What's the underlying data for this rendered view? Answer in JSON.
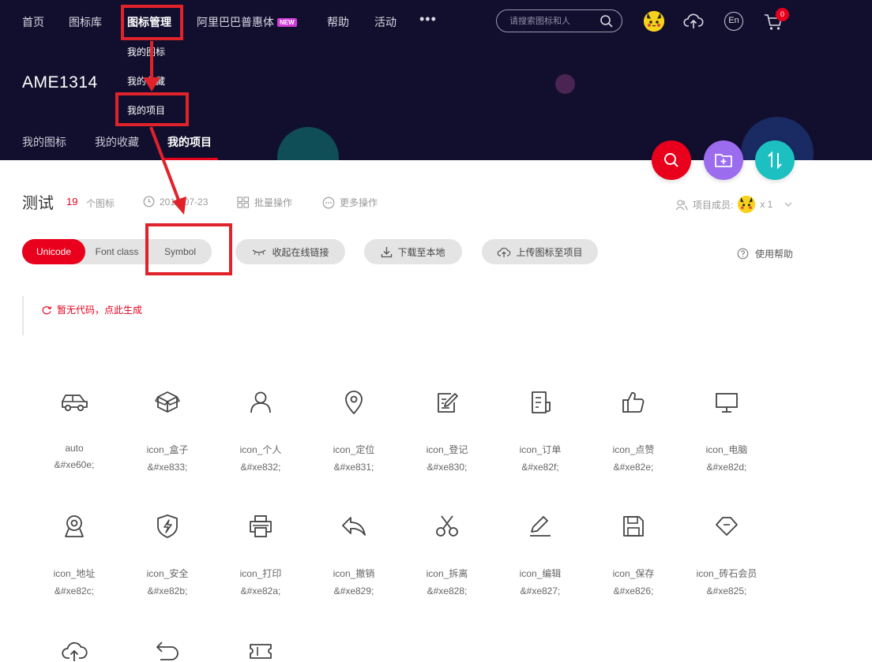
{
  "nav": {
    "items": [
      {
        "label": "首页"
      },
      {
        "label": "图标库"
      },
      {
        "label": "图标管理"
      },
      {
        "label": "阿里巴巴普惠体",
        "badge": "NEW"
      },
      {
        "label": "帮助"
      },
      {
        "label": "活动"
      }
    ],
    "more": "•••",
    "search_placeholder": "请搜索图标和人",
    "lang": "En",
    "cart_count": "0"
  },
  "dropdown": [
    "我的图标",
    "我的收藏",
    "我的项目"
  ],
  "user": {
    "name": "AME1314"
  },
  "subnav": [
    "我的图标",
    "我的收藏",
    "我的项目"
  ],
  "project": {
    "name": "测试",
    "count": "19",
    "count_label": "个图标",
    "date": "2019-07-23",
    "batch": "批量操作",
    "more": "更多操作",
    "members_label": "项目成员:",
    "members_count": "x 1"
  },
  "tabs": [
    "Unicode",
    "Font class",
    "Symbol"
  ],
  "actions": {
    "collapse": "收起在线链接",
    "download": "下载至本地",
    "upload": "上传图标至项目",
    "help": "使用帮助"
  },
  "code_area": {
    "generate": "暂无代码，点此生成"
  },
  "icons": [
    {
      "name": "auto",
      "code": "&#xe60e;",
      "icon": "car-icon"
    },
    {
      "name": "icon_盒子",
      "code": "&#xe833;",
      "icon": "box-icon"
    },
    {
      "name": "icon_个人",
      "code": "&#xe832;",
      "icon": "person-icon"
    },
    {
      "name": "icon_定位",
      "code": "&#xe831;",
      "icon": "location-pin-icon"
    },
    {
      "name": "icon_登记",
      "code": "&#xe830;",
      "icon": "register-icon"
    },
    {
      "name": "icon_订单",
      "code": "&#xe82f;",
      "icon": "order-icon"
    },
    {
      "name": "icon_点赞",
      "code": "&#xe82e;",
      "icon": "thumbs-up-icon"
    },
    {
      "name": "icon_电脑",
      "code": "&#xe82d;",
      "icon": "computer-icon"
    },
    {
      "name": "icon_地址",
      "code": "&#xe82c;",
      "icon": "address-icon"
    },
    {
      "name": "icon_安全",
      "code": "&#xe82b;",
      "icon": "shield-icon"
    },
    {
      "name": "icon_打印",
      "code": "&#xe82a;",
      "icon": "printer-icon"
    },
    {
      "name": "icon_撤销",
      "code": "&#xe829;",
      "icon": "undo-icon"
    },
    {
      "name": "icon_拆离",
      "code": "&#xe828;",
      "icon": "scissors-icon"
    },
    {
      "name": "icon_编辑",
      "code": "&#xe827;",
      "icon": "edit-icon"
    },
    {
      "name": "icon_保存",
      "code": "&#xe826;",
      "icon": "save-icon"
    },
    {
      "name": "icon_砖石会员",
      "code": "&#xe825;",
      "icon": "diamond-icon"
    },
    {
      "name": "",
      "code": "",
      "icon": "cloud-upload-icon"
    },
    {
      "name": "",
      "code": "",
      "icon": "return-icon"
    },
    {
      "name": "",
      "code": "",
      "icon": "ticket-icon"
    }
  ],
  "colors": {
    "header_bg": "#120f2e",
    "accent_red": "#e8001c",
    "fab_purple": "#9b6cee",
    "fab_teal": "#1cc0c0",
    "annotation_red": "#e0222a"
  }
}
